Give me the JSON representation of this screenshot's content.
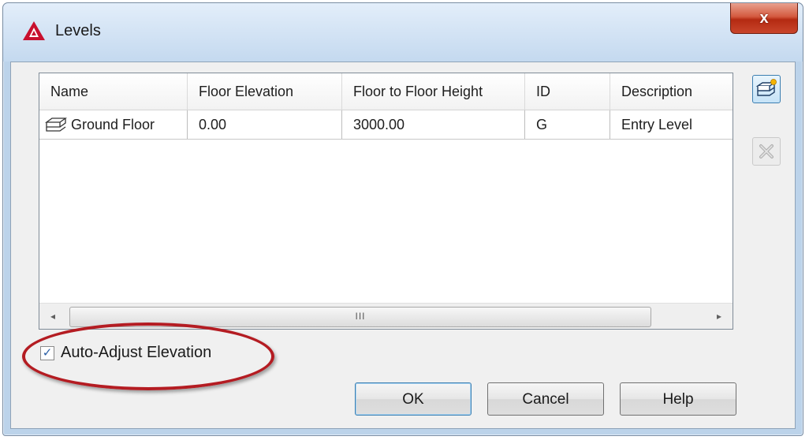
{
  "window": {
    "title": "Levels",
    "close_glyph": "x",
    "app_icon": "autocad-logo-icon"
  },
  "table": {
    "columns": [
      "Name",
      "Floor Elevation",
      "Floor to Floor Height",
      "ID",
      "Description"
    ],
    "rows": [
      {
        "icon": "level-stack-icon",
        "name": "Ground Floor",
        "floor_elevation": "0.00",
        "floor_to_floor_height": "3000.00",
        "id": "G",
        "description": "Entry Level"
      }
    ],
    "scrollbar": {
      "left_arrow": "◂",
      "right_arrow": "▸",
      "thumb_grip": "III"
    }
  },
  "side_buttons": {
    "add_icon": "add-level-icon",
    "delete_icon": "delete-level-icon"
  },
  "options": {
    "auto_adjust_label": "Auto-Adjust Elevation",
    "auto_adjust_checked": true,
    "check_glyph": "✓"
  },
  "buttons": {
    "ok": "OK",
    "cancel": "Cancel",
    "help": "Help"
  },
  "colors": {
    "highlight": "#b41c22",
    "close_button": "#c9452b",
    "accent_blue": "#3c7fb1"
  }
}
